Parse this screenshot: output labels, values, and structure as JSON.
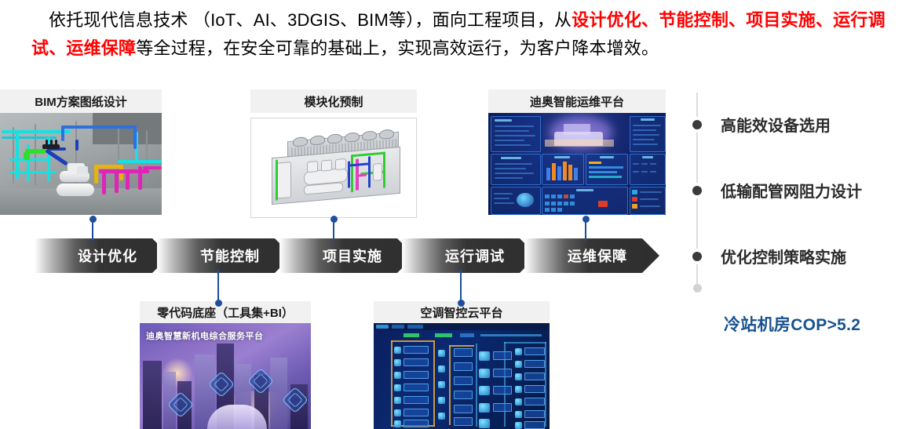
{
  "headline": {
    "part1": "依托现代信息技术 （IoT、AI、3DGIS、BIM等），面向工程项目，从",
    "highlight1": "设计优化、节能控制、项目实施、运行调试、运维保障",
    "part2": "等全过程，在安全可靠的基础上，实现高效运行，为客户降本增效。"
  },
  "cards": [
    {
      "id": "bim",
      "title": "BIM方案图纸设计"
    },
    {
      "id": "mod",
      "title": "模块化预制"
    },
    {
      "id": "plat",
      "title": "迪奥智能运维平台"
    },
    {
      "id": "zero",
      "title": "零代码底座（工具集+BI）"
    },
    {
      "id": "hvac",
      "title": "空调智控云平台"
    }
  ],
  "process_steps": [
    {
      "label": "设计优化"
    },
    {
      "label": "节能控制"
    },
    {
      "label": "项目实施"
    },
    {
      "label": "运行调试"
    },
    {
      "label": "运维保障"
    }
  ],
  "timeline": {
    "items": [
      {
        "label": "高能效设备选用"
      },
      {
        "label": "低输配管网阻力设计"
      },
      {
        "label": "优化控制策略实施"
      }
    ]
  },
  "kpi": {
    "text": "冷站机房COP>5.2"
  },
  "artwork": {
    "zero_code_title": "迪奥智慧新机电综合服务平台"
  },
  "colors": {
    "highlight_red": "#ff0000",
    "kpi_blue": "#17538f",
    "connector_blue": "#1f4e9c",
    "chevron_dark": "#2e2e2e",
    "card_head_bg": "#f1f1f1",
    "timeline_line": "#dcdcdc"
  }
}
